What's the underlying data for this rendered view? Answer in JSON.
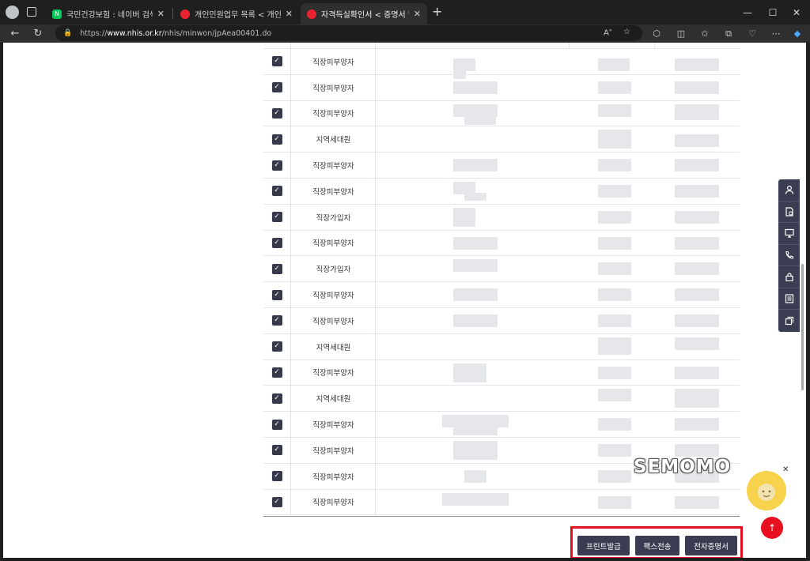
{
  "browser": {
    "tabs": [
      {
        "title": "국민건강보험 : 네이버 검색",
        "favicon": "naver"
      },
      {
        "title": "개인민원업무 목록 < 개인민원 <",
        "favicon": "nhis"
      },
      {
        "title": "자격득실확인서 < 증명서 발급/확",
        "favicon": "nhis",
        "active": true
      }
    ],
    "url_prefix": "https://",
    "url_domain": "www.nhis.or.kr",
    "url_path": "/nhis/minwon/jpAea00401.do"
  },
  "table": {
    "rows": [
      {
        "type": "직장피부양자",
        "checked": true
      },
      {
        "type": "직장피부양자",
        "checked": true
      },
      {
        "type": "직장피부양자",
        "checked": true
      },
      {
        "type": "지역세대원",
        "checked": true
      },
      {
        "type": "직장피부양자",
        "checked": true
      },
      {
        "type": "직장피부양자",
        "checked": true
      },
      {
        "type": "직장가입자",
        "checked": true
      },
      {
        "type": "직장피부양자",
        "checked": true
      },
      {
        "type": "직장가입자",
        "checked": true
      },
      {
        "type": "직장피부양자",
        "checked": true
      },
      {
        "type": "직장피부양자",
        "checked": true
      },
      {
        "type": "지역세대원",
        "checked": true
      },
      {
        "type": "직장피부양자",
        "checked": true
      },
      {
        "type": "지역세대원",
        "checked": true
      },
      {
        "type": "직장피부양자",
        "checked": true
      },
      {
        "type": "직장피부양자",
        "checked": true
      },
      {
        "type": "직장피부양자",
        "checked": true
      },
      {
        "type": "직장피부양자",
        "checked": true
      }
    ]
  },
  "actions": {
    "print": "프린트발급",
    "fax": "팩스전송",
    "digital": "전자증명서"
  },
  "quick_menu": [
    "person-icon",
    "document-icon",
    "monitor-icon",
    "phone-icon",
    "lock-icon",
    "list-icon",
    "copy-icon"
  ],
  "watermark": "SEMOMO",
  "colors": {
    "accent": "#e0101e",
    "button": "#3a3d52",
    "checkbox": "#37384a"
  }
}
